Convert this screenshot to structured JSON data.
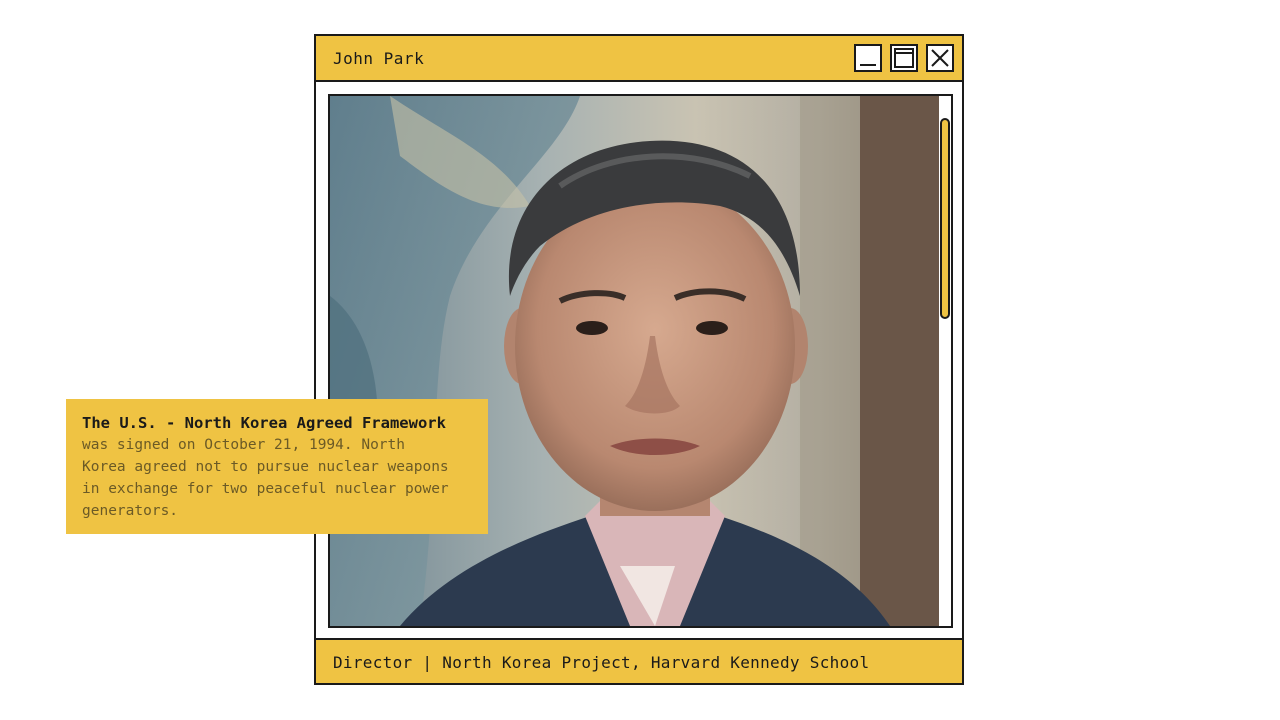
{
  "window": {
    "title": "John Park",
    "footer_caption": "Director | North Korea Project, Harvard Kennedy School",
    "buttons": {
      "minimize": "minimize-icon",
      "maximize": "maximize-icon",
      "close": "close-icon"
    },
    "scroll_position": 0.0,
    "scroll_visible_fraction": 0.38
  },
  "callout": {
    "title": "The U.S. - North Korea Agreed Framework",
    "body_lines": [
      "was signed on October 21, 1994. North",
      "Korea agreed not to pursue nuclear weapons",
      "in exchange for two peaceful nuclear power",
      "generators."
    ]
  },
  "colors": {
    "accent": "#efc343",
    "border": "#1a1a1a",
    "background": "#ffffff"
  }
}
